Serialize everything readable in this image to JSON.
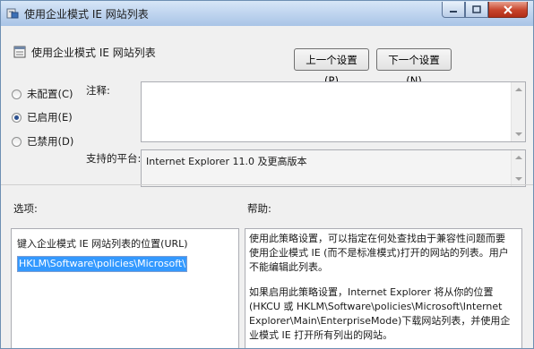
{
  "window": {
    "title": "使用企业模式 IE 网站列表",
    "controls": {
      "minimize_icon": "minimize-icon",
      "maximize_icon": "maximize-icon",
      "close_icon": "close-icon"
    }
  },
  "header": {
    "policy_title": "使用企业模式 IE 网站列表",
    "prev_button": "上一个设置(P)",
    "next_button": "下一个设置(N)"
  },
  "state": {
    "options": [
      {
        "label": "未配置(C)",
        "selected": false
      },
      {
        "label": "已启用(E)",
        "selected": true
      },
      {
        "label": "已禁用(D)",
        "selected": false
      }
    ]
  },
  "comment": {
    "label": "注释:",
    "value": ""
  },
  "platform": {
    "label": "支持的平台:",
    "value": "Internet Explorer 11.0 及更高版本"
  },
  "options_section": {
    "label": "选项:",
    "field_label": "键入企业模式 IE 网站列表的位置(URL)",
    "field_value": "HKLM\\Software\\policies\\Microsoft\\Ir"
  },
  "help_section": {
    "label": "帮助:",
    "paragraphs": [
      "使用此策略设置，可以指定在何处查找由于兼容性问题而要使用企业模式 IE (而不是标准模式)打开的网站的列表。用户不能编辑此列表。",
      "如果启用此策略设置，Internet Explorer 将从你的位置(HKCU 或 HKLM\\Software\\policies\\Microsoft\\Internet Explorer\\Main\\EnterpriseMode)下载网站列表，并使用企业模式 IE 打开所有列出的网站。"
    ]
  },
  "colors": {
    "title_bar": "#bdd3ee",
    "close_button": "#c7442b",
    "selection": "#3399ff",
    "dialog_bg": "#f0f0f0"
  }
}
